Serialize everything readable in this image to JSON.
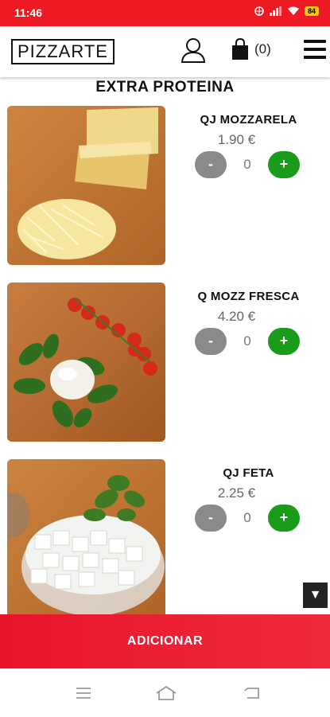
{
  "status_bar": {
    "time": "11:46",
    "battery": "84"
  },
  "header": {
    "logo": "PIZZARTE",
    "cart_count": "(0)",
    "icons": [
      "user-icon",
      "shopping-bag-icon",
      "hamburger-menu-icon"
    ]
  },
  "section_title": "EXTRA PROTEINA",
  "products": [
    {
      "name": "QJ MOZZARELA",
      "price": "1.90 €",
      "quantity": "0",
      "minus_label": "-",
      "plus_label": "+"
    },
    {
      "name": "Q MOZZ FRESCA",
      "price": "4.20 €",
      "quantity": "0",
      "minus_label": "-",
      "plus_label": "+"
    },
    {
      "name": "QJ FETA",
      "price": "2.25 €",
      "quantity": "0",
      "minus_label": "-",
      "plus_label": "+"
    }
  ],
  "scroll_button": "▼",
  "add_button": "ADICIONAR",
  "colors": {
    "accent": "#ee1a23",
    "plus": "#1a9b1a",
    "minus": "#8a8a8a"
  }
}
